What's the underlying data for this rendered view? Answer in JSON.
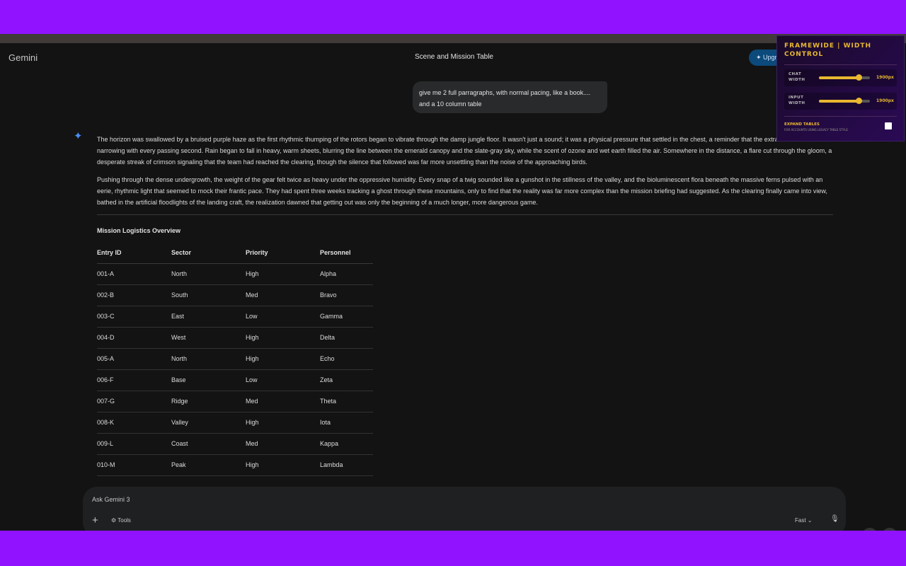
{
  "app": {
    "brand": "Gemini",
    "title": "Scene and Mission Table",
    "upgrade": "Upgrade"
  },
  "user_message": "give me 2 full parragraphs, with normal pacing, like a book.... and a 10 column table",
  "response": {
    "paragraphs": [
      "The horizon was swallowed by a bruised purple haze as the first rhythmic thumping of the rotors began to vibrate through the damp jungle floor. It wasn't just a sound; it was a physical pressure that settled in the chest, a reminder that the extraction window was narrowing with every passing second. Rain began to fall in heavy, warm sheets, blurring the line between the emerald canopy and the slate-gray sky, while the scent of ozone and wet earth filled the air. Somewhere in the distance, a flare cut through the gloom, a desperate streak of crimson signaling that the team had reached the clearing, though the silence that followed was far more unsettling than the noise of the approaching birds.",
      "Pushing through the dense undergrowth, the weight of the gear felt twice as heavy under the oppressive humidity. Every snap of a twig sounded like a gunshot in the stillness of the valley, and the bioluminescent flora beneath the massive ferns pulsed with an eerie, rhythmic light that seemed to mock their frantic pace. They had spent three weeks tracking a ghost through these mountains, only to find that the reality was far more complex than the mission briefing had suggested. As the clearing finally came into view, bathed in the artificial floodlights of the landing craft, the realization dawned that getting out was only the beginning of a much longer, more dangerous game."
    ],
    "table_title": "Mission Logistics Overview",
    "columns": [
      "Entry ID",
      "Sector",
      "Priority",
      "Personnel"
    ],
    "rows": [
      [
        "001-A",
        "North",
        "High",
        "Alpha"
      ],
      [
        "002-B",
        "South",
        "Med",
        "Bravo"
      ],
      [
        "003-C",
        "East",
        "Low",
        "Gamma"
      ],
      [
        "004-D",
        "West",
        "High",
        "Delta"
      ],
      [
        "005-A",
        "North",
        "High",
        "Echo"
      ],
      [
        "006-F",
        "Base",
        "Low",
        "Zeta"
      ],
      [
        "007-G",
        "Ridge",
        "Med",
        "Theta"
      ],
      [
        "008-K",
        "Valley",
        "High",
        "Iota"
      ],
      [
        "009-L",
        "Coast",
        "Med",
        "Kappa"
      ],
      [
        "010-M",
        "Peak",
        "High",
        "Lambda"
      ]
    ]
  },
  "input": {
    "placeholder": "Ask Gemini 3",
    "tools": "Tools",
    "mode": "Fast"
  },
  "panel": {
    "title": "FRAMEWIDE | WIDTH CONTROL",
    "chat_label": "CHAT WIDTH",
    "chat_value": "1900px",
    "chat_fraction": 0.78,
    "input_label": "INPUT WIDTH",
    "input_value": "1900px",
    "input_fraction": 0.78,
    "expand_label": "EXPAND TABLES",
    "expand_sub": "FOR ACCOUNTS USING LEGACY TABLE STYLE"
  }
}
